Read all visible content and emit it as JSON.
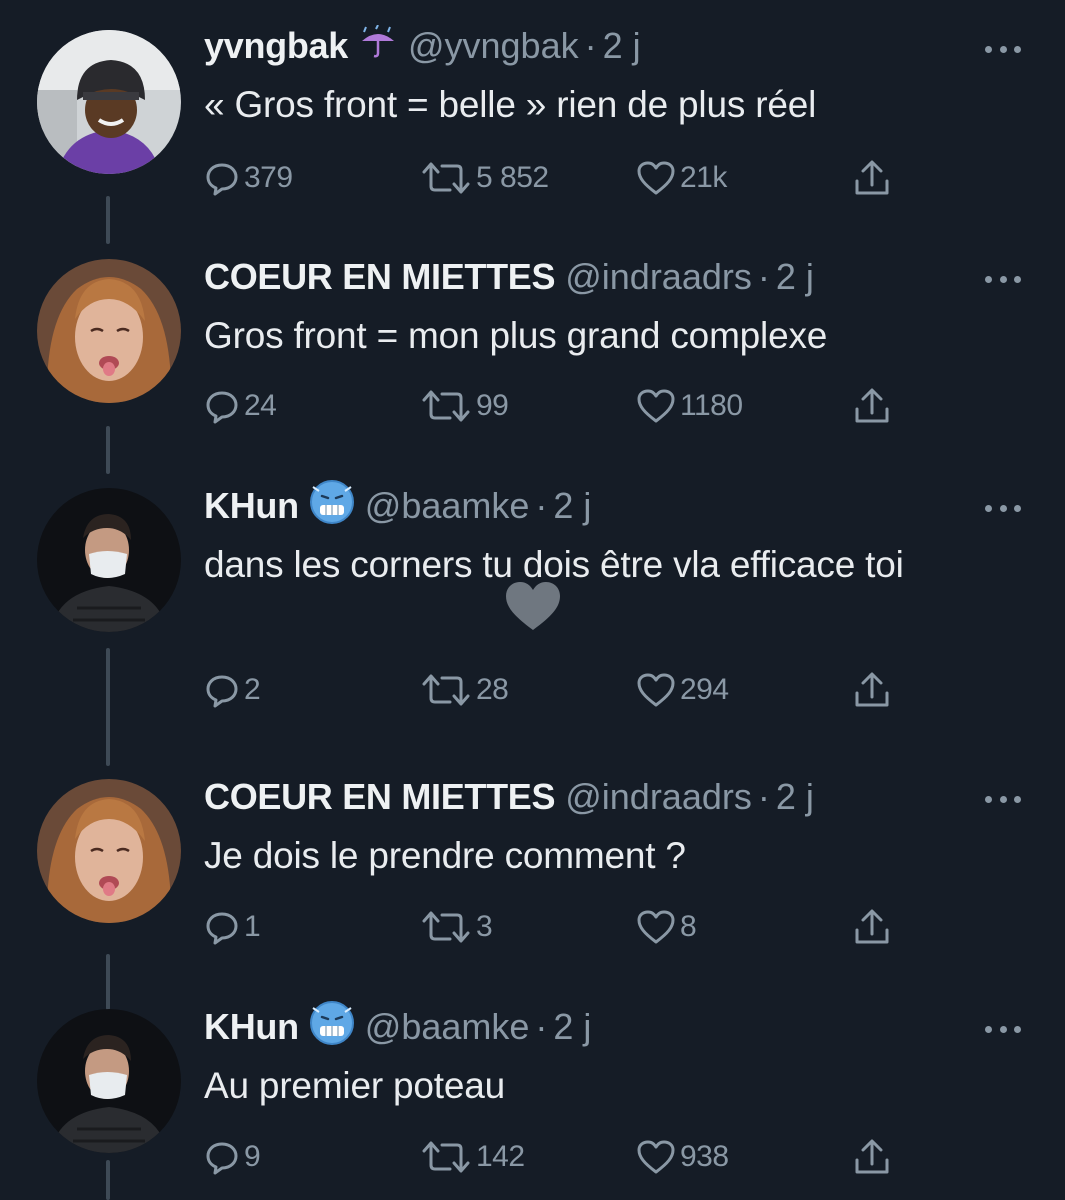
{
  "tweets": [
    {
      "name": "yvngbak",
      "handle": "@yvngbak",
      "dot": "·",
      "time": "2 j",
      "badge_icon": "umbrella-rain-icon",
      "text": "« Gros front = belle » rien de plus réel",
      "replies": "379",
      "retweets": "5 852",
      "likes": "21k"
    },
    {
      "name": "COEUR EN MIETTES",
      "handle": "@indraadrs",
      "dot": "·",
      "time": "2 j",
      "text": "Gros front = mon plus grand complexe",
      "replies": "24",
      "retweets": "99",
      "likes": "1180"
    },
    {
      "name": "KHun",
      "handle": "@baamke",
      "dot": "·",
      "time": "2 j",
      "badge_icon": "cold-face-icon",
      "text": "dans les corners tu dois être vla efficace toi",
      "replies": "2",
      "retweets": "28",
      "likes": "294"
    },
    {
      "name": "COEUR EN MIETTES",
      "handle": "@indraadrs",
      "dot": "·",
      "time": "2 j",
      "text": "Je dois le prendre comment ?",
      "replies": "1",
      "retweets": "3",
      "likes": "8"
    },
    {
      "name": "KHun",
      "handle": "@baamke",
      "dot": "·",
      "time": "2 j",
      "badge_icon": "cold-face-icon",
      "text": "Au premier poteau",
      "replies": "9",
      "retweets": "142",
      "likes": "938"
    }
  ],
  "colors": {
    "background": "#151c26",
    "text": "#e9ecef",
    "muted": "#8a98a5",
    "connector": "#3e4a56"
  }
}
